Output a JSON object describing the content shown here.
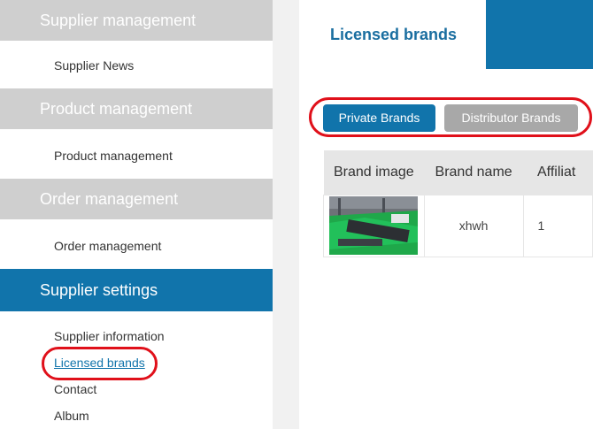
{
  "sidebar": {
    "sections": [
      {
        "title": "Supplier management",
        "items": [
          "Supplier News"
        ]
      },
      {
        "title": "Product management",
        "items": [
          "Product management"
        ]
      },
      {
        "title": "Order management",
        "items": [
          "Order management"
        ]
      },
      {
        "title": "Supplier settings",
        "items": [
          "Supplier information",
          "Licensed brands",
          "Contact",
          "Album"
        ]
      }
    ]
  },
  "main": {
    "title": "Licensed brands",
    "buttons": {
      "private": "Private Brands",
      "distributor": "Distributor Brands"
    },
    "table": {
      "headers": [
        "Brand image",
        "Brand name",
        "Affiliat"
      ],
      "rows": [
        {
          "brand_name": "xhwh",
          "affiliation": "1"
        }
      ]
    }
  },
  "colors": {
    "accent": "#1174ab",
    "highlight": "#e0101a",
    "section_gray": "#cfcfcf"
  }
}
